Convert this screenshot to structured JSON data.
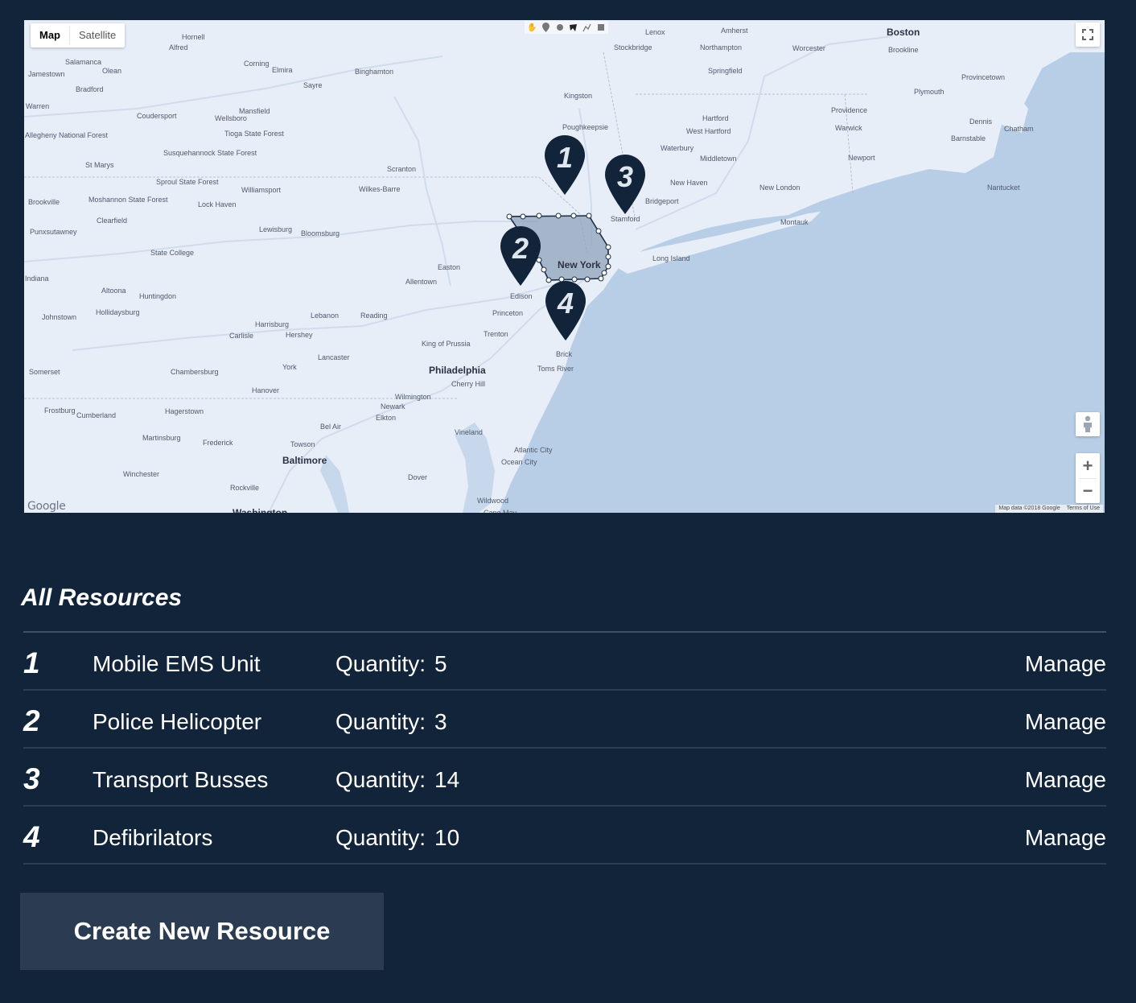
{
  "map": {
    "type_control": {
      "map_label": "Map",
      "satellite_label": "Satellite",
      "active": "Map"
    },
    "drawing_tools": [
      "hand-icon",
      "marker-icon",
      "circle-icon",
      "polygon-icon",
      "polyline-icon",
      "rectangle-icon"
    ],
    "controls": {
      "fullscreen_icon": "fullscreen-icon",
      "pegman_icon": "pegman-icon",
      "zoom_in_label": "+",
      "zoom_out_label": "−"
    },
    "google_logo": "Google",
    "attribution": {
      "map_data": "Map data ©2018 Google",
      "terms": "Terms of Use"
    },
    "colors": {
      "land": "#e8eef8",
      "water": "#b8cde6",
      "polygon_fill": "#8fa3bc",
      "marker": "#12243a"
    },
    "places": [
      {
        "name": "Boston",
        "major": true
      },
      {
        "name": "Brookline",
        "major": false
      },
      {
        "name": "Worcester",
        "major": false
      },
      {
        "name": "Springfield",
        "major": false
      },
      {
        "name": "Providence",
        "major": false
      },
      {
        "name": "Warwick",
        "major": false
      },
      {
        "name": "Hartford",
        "major": false
      },
      {
        "name": "West Hartford",
        "major": false
      },
      {
        "name": "Waterbury",
        "major": false
      },
      {
        "name": "Middletown",
        "major": false
      },
      {
        "name": "New Haven",
        "major": false
      },
      {
        "name": "Bridgeport",
        "major": false
      },
      {
        "name": "Stamford",
        "major": false
      },
      {
        "name": "New London",
        "major": false
      },
      {
        "name": "Newport",
        "major": false
      },
      {
        "name": "Plymouth",
        "major": false
      },
      {
        "name": "Provincetown",
        "major": false
      },
      {
        "name": "Barnstable",
        "major": false
      },
      {
        "name": "Nantucket",
        "major": false
      },
      {
        "name": "Montauk",
        "major": false
      },
      {
        "name": "Long Island",
        "major": false
      },
      {
        "name": "New York",
        "major": true
      },
      {
        "name": "Poughkeepsie",
        "major": false
      },
      {
        "name": "Kingston",
        "major": false
      },
      {
        "name": "Binghamton",
        "major": false
      },
      {
        "name": "Scranton",
        "major": false
      },
      {
        "name": "Wilkes-Barre",
        "major": false
      },
      {
        "name": "Allentown",
        "major": false
      },
      {
        "name": "Easton",
        "major": false
      },
      {
        "name": "Edison",
        "major": false
      },
      {
        "name": "Princeton",
        "major": false
      },
      {
        "name": "Trenton",
        "major": false
      },
      {
        "name": "Reading",
        "major": false
      },
      {
        "name": "Philadelphia",
        "major": true
      },
      {
        "name": "Cherry Hill",
        "major": false
      },
      {
        "name": "Wilmington",
        "major": false
      },
      {
        "name": "Newark",
        "major": false
      },
      {
        "name": "Elkton",
        "major": false
      },
      {
        "name": "Vineland",
        "major": false
      },
      {
        "name": "Atlantic City",
        "major": false
      },
      {
        "name": "Ocean City",
        "major": false
      },
      {
        "name": "Brick",
        "major": false
      },
      {
        "name": "Toms River",
        "major": false
      },
      {
        "name": "Dover",
        "major": false
      },
      {
        "name": "Wildwood",
        "major": false
      },
      {
        "name": "Cape May",
        "major": false
      },
      {
        "name": "Lancaster",
        "major": false
      },
      {
        "name": "Harrisburg",
        "major": false
      },
      {
        "name": "Hershey",
        "major": false
      },
      {
        "name": "Lebanon",
        "major": false
      },
      {
        "name": "York",
        "major": false
      },
      {
        "name": "Hanover",
        "major": false
      },
      {
        "name": "Baltimore",
        "major": true
      },
      {
        "name": "Towson",
        "major": false
      },
      {
        "name": "Bel Air",
        "major": false
      },
      {
        "name": "Washington",
        "major": true
      },
      {
        "name": "Rockville",
        "major": false
      },
      {
        "name": "Frederick",
        "major": false
      },
      {
        "name": "Hagerstown",
        "major": false
      },
      {
        "name": "Martinsburg",
        "major": false
      },
      {
        "name": "Winchester",
        "major": false
      },
      {
        "name": "Chambersburg",
        "major": false
      },
      {
        "name": "Carlisle",
        "major": false
      },
      {
        "name": "State College",
        "major": false
      },
      {
        "name": "Altoona",
        "major": false
      },
      {
        "name": "Huntingdon",
        "major": false
      },
      {
        "name": "Hollidaysburg",
        "major": false
      },
      {
        "name": "Johnstown",
        "major": false
      },
      {
        "name": "Somerset",
        "major": false
      },
      {
        "name": "Frostburg",
        "major": false
      },
      {
        "name": "Cumberland",
        "major": false
      },
      {
        "name": "Lewisburg",
        "major": false
      },
      {
        "name": "Bloomsburg",
        "major": false
      },
      {
        "name": "Williamsport",
        "major": false
      },
      {
        "name": "Lock Haven",
        "major": false
      },
      {
        "name": "Clearfield",
        "major": false
      },
      {
        "name": "Punxsutawney",
        "major": false
      },
      {
        "name": "Brookville",
        "major": false
      },
      {
        "name": "Moshannon State Forest",
        "major": false
      },
      {
        "name": "Sproul State Forest",
        "major": false
      },
      {
        "name": "Susquehannock State Forest",
        "major": false
      },
      {
        "name": "Tioga State Forest",
        "major": false
      },
      {
        "name": "Mansfield",
        "major": false
      },
      {
        "name": "Wellsboro",
        "major": false
      },
      {
        "name": "Coudersport",
        "major": false
      },
      {
        "name": "Allegheny National Forest",
        "major": false
      },
      {
        "name": "Warren",
        "major": false
      },
      {
        "name": "Bradford",
        "major": false
      },
      {
        "name": "Olean",
        "major": false
      },
      {
        "name": "Salamanca",
        "major": false
      },
      {
        "name": "Jamestown",
        "major": false
      },
      {
        "name": "Alfred",
        "major": false
      },
      {
        "name": "Hornell",
        "major": false
      },
      {
        "name": "Corning",
        "major": false
      },
      {
        "name": "Elmira",
        "major": false
      },
      {
        "name": "Sayre",
        "major": false
      },
      {
        "name": "St Marys",
        "major": false
      },
      {
        "name": "Stockbridge",
        "major": false
      },
      {
        "name": "Northampton",
        "major": false
      },
      {
        "name": "Amherst",
        "major": false
      },
      {
        "name": "Lenox",
        "major": false
      },
      {
        "name": "Dennis",
        "major": false
      },
      {
        "name": "Chatham",
        "major": false
      },
      {
        "name": "King of Prussia",
        "major": false
      },
      {
        "name": "Indiana",
        "major": false
      }
    ]
  },
  "resources": {
    "title": "All Resources",
    "quantity_label": "Quantity:",
    "manage_label": "Manage",
    "items": [
      {
        "number": "1",
        "name": "Mobile EMS Unit",
        "quantity": "5"
      },
      {
        "number": "2",
        "name": "Police Helicopter",
        "quantity": "3"
      },
      {
        "number": "3",
        "name": "Transport Busses",
        "quantity": "14"
      },
      {
        "number": "4",
        "name": "Defibrilators",
        "quantity": "10"
      }
    ]
  },
  "create_button": {
    "label": "Create New Resource"
  }
}
